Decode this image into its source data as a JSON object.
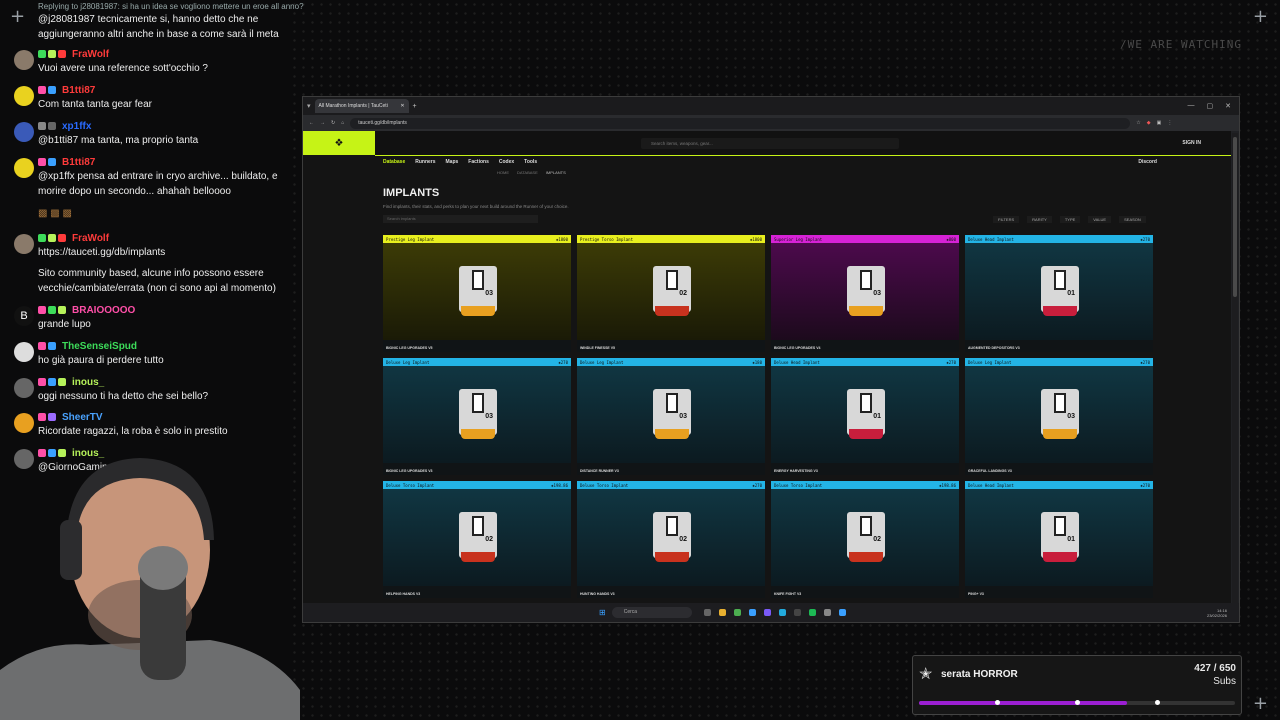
{
  "overlay": {
    "watermark": "/WE ARE WATCHING",
    "corner_icon": "crosshair-plus"
  },
  "chat": {
    "reply_notice": "Replying to j28081987: si ha un idea se vogliono mettere un eroe all anno?",
    "messages": [
      {
        "user": "",
        "text": "@j28081987 tecnicamente si, hanno detto che ne aggiungeranno altri anche in base a come sarà il meta",
        "color": "#ffffff"
      },
      {
        "user": "FraWolf",
        "text": "Vuoi avere una reference sott'occhio ?",
        "color": "#ff3b3b"
      },
      {
        "user": "B1tti87",
        "text": "Com tanta tanta gear fear",
        "color": "#ff3b3b"
      },
      {
        "user": "xp1ffx",
        "text": "@b1tti87 ma tanta, ma proprio tanta",
        "color": "#2a6bff"
      },
      {
        "user": "B1tti87",
        "text": "@xp1ffx pensa ad entrare in cryo archive... buildato, e morire dopo un secondo... ahahah belloooo",
        "color": "#ff3b3b"
      },
      {
        "user": "FraWolf",
        "text": "https://tauceti.gg/db/implants",
        "color": "#ff3b3b"
      },
      {
        "user": "",
        "text": "Sito community based, alcune info possono essere vecchie/cambiate/errata (non ci sono api al momento)",
        "color": "#ffffff"
      },
      {
        "user": "BRAIOOOOO",
        "text": "grande lupo",
        "color": "#ff4fa8"
      },
      {
        "user": "TheSenseiSpud",
        "text": "ho già paura di perdere tutto",
        "color": "#3ddc5a"
      },
      {
        "user": "inous_",
        "text": "oggi nessuno ti ha detto che sei bello?",
        "color": "#b6f25a"
      },
      {
        "user": "SheerTV",
        "text": "Ricordate ragazzi, la roba è solo in prestito",
        "color": "#4aa3ff"
      },
      {
        "user": "inous_",
        "text": "@GiornoGamin",
        "color": "#b6f25a"
      }
    ]
  },
  "browser": {
    "tab_title": "All Marathon Implants | TauCeti",
    "url": "tauceti.gg/db/implants",
    "site": {
      "search_placeholder": "Search items, weapons, gear...",
      "sign_in": "SIGN IN",
      "nav": [
        "Database",
        "Runners",
        "Maps",
        "Factions",
        "Codex",
        "Tools"
      ],
      "discord": "Discord",
      "breadcrumbs": [
        "HOME",
        "DATABASE",
        "IMPLANTS"
      ],
      "title": "IMPLANTS",
      "subtitle": "Find implants, their stats, and perks to plan your next build around the Runner of your choice.",
      "list_search": "Search implants",
      "filters": [
        "FILTERS",
        "RARITY",
        "TYPE",
        "VALUE",
        "SEASON"
      ],
      "cards": [
        {
          "head": "Prestige Leg Implant",
          "price": "◈1800",
          "foot": "BIONIC LEG UPGRADES V5",
          "rarity": "gold",
          "num": "03",
          "headcolor": "#e8ef1e"
        },
        {
          "head": "Prestige Torso Implant",
          "price": "◈1800",
          "foot": "WINDLE FINESSE V5",
          "rarity": "gold",
          "num": "02",
          "headcolor": "#e8ef1e"
        },
        {
          "head": "Superior Leg Implant",
          "price": "◈800",
          "foot": "BIONIC LEG UPGRADES V4",
          "rarity": "pink",
          "num": "03",
          "headcolor": "#d622d6"
        },
        {
          "head": "Deluxe Head Implant",
          "price": "◈270",
          "foot": "AUGMENTED DEPOSITORS V3",
          "rarity": "teal",
          "num": "01",
          "headcolor": "#23b4e6"
        },
        {
          "head": "Deluxe Leg Implant",
          "price": "◈270",
          "foot": "BIONIC LEG UPGRADES V3",
          "rarity": "teal",
          "num": "03",
          "headcolor": "#23b4e6"
        },
        {
          "head": "Deluxe Leg Implant",
          "price": "◈180",
          "foot": "DISTANCE RUNNER V3",
          "rarity": "teal",
          "num": "03",
          "headcolor": "#23b4e6"
        },
        {
          "head": "Deluxe Head Implant",
          "price": "◈270",
          "foot": "ENERGY HARVESTING V3",
          "rarity": "teal",
          "num": "01",
          "headcolor": "#23b4e6"
        },
        {
          "head": "Deluxe Leg Implant",
          "price": "◈270",
          "foot": "GRACEFUL LANDINGS V3",
          "rarity": "teal",
          "num": "03",
          "headcolor": "#23b4e6"
        },
        {
          "head": "Deluxe Torso Implant",
          "price": "◈198.86",
          "foot": "HELPING HANDS V3",
          "rarity": "teal",
          "num": "02",
          "headcolor": "#23b4e6"
        },
        {
          "head": "Deluxe Torso Implant",
          "price": "◈270",
          "foot": "HUNTING HANDS V3",
          "rarity": "teal",
          "num": "02",
          "headcolor": "#23b4e6"
        },
        {
          "head": "Deluxe Torso Implant",
          "price": "◈198.86",
          "foot": "KNIFE FIGHT V3",
          "rarity": "teal",
          "num": "02",
          "headcolor": "#23b4e6"
        },
        {
          "head": "Deluxe Head Implant",
          "price": "◈270",
          "foot": "PING+ V3",
          "rarity": "teal",
          "num": "01",
          "headcolor": "#23b4e6"
        }
      ]
    },
    "taskbar": {
      "search": "Cerca",
      "time": "14:16",
      "date": "23/02/2026"
    }
  },
  "goal": {
    "title": "serata HORROR",
    "current": "427",
    "target": "650",
    "count_text": "427 / 650",
    "unit": "Subs",
    "progress": 0.657,
    "accent": "#9b1fd2"
  }
}
